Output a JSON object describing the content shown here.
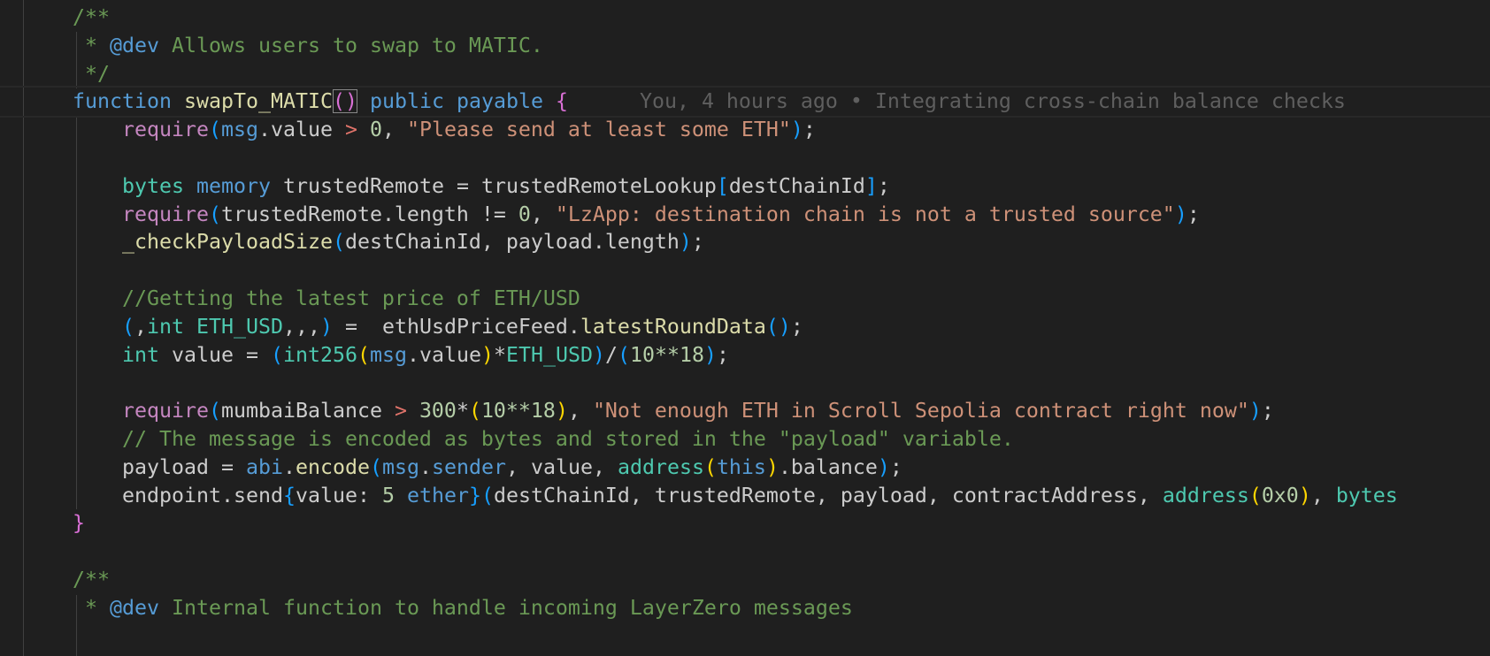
{
  "editor": {
    "language": "solidity",
    "current_line": 4,
    "blame": "You, 4 hours ago • Integrating cross-chain balance checks",
    "colors": {
      "background": "#1f1f1f",
      "keyword": "#569cd6",
      "type": "#4ec9b0",
      "function": "#dcdcaa",
      "control": "#c586c0",
      "string": "#ce9178",
      "number": "#b5cea8",
      "comment": "#6a9955"
    },
    "lines": [
      [
        [
          "    ",
          "d"
        ],
        [
          "/**",
          "c"
        ]
      ],
      [
        [
          "     * ",
          "c"
        ],
        [
          "@dev",
          "k"
        ],
        [
          " Allows users to swap to MATIC.",
          "c"
        ]
      ],
      [
        [
          "     */",
          "c"
        ]
      ],
      [
        [
          "    ",
          "d"
        ],
        [
          "function",
          "k"
        ],
        [
          " ",
          "d"
        ],
        [
          "swapTo_MATIC",
          "f"
        ],
        [
          "()",
          "b2 match"
        ],
        [
          " ",
          "d"
        ],
        [
          "public",
          "k"
        ],
        [
          " ",
          "d"
        ],
        [
          "payable",
          "k"
        ],
        [
          " ",
          "d"
        ],
        [
          "{",
          "b2"
        ]
      ],
      [
        [
          "        ",
          "d"
        ],
        [
          "require",
          "p"
        ],
        [
          "(",
          "b3"
        ],
        [
          "msg",
          "k"
        ],
        [
          ".value ",
          "d"
        ],
        [
          ">",
          "op"
        ],
        [
          " ",
          "d"
        ],
        [
          "0",
          "n"
        ],
        [
          ", ",
          "d"
        ],
        [
          "\"Please send at least some ETH\"",
          "s"
        ],
        [
          ")",
          "b3"
        ],
        [
          ";",
          "d"
        ]
      ],
      [],
      [
        [
          "        ",
          "d"
        ],
        [
          "bytes",
          "t"
        ],
        [
          " ",
          "d"
        ],
        [
          "memory",
          "k"
        ],
        [
          " trustedRemote = trustedRemoteLookup",
          "d"
        ],
        [
          "[",
          "b3"
        ],
        [
          "destChainId",
          "d"
        ],
        [
          "]",
          "b3"
        ],
        [
          ";",
          "d"
        ]
      ],
      [
        [
          "        ",
          "d"
        ],
        [
          "require",
          "p"
        ],
        [
          "(",
          "b3"
        ],
        [
          "trustedRemote.length != ",
          "d"
        ],
        [
          "0",
          "n"
        ],
        [
          ", ",
          "d"
        ],
        [
          "\"LzApp: destination chain is not a trusted source\"",
          "s"
        ],
        [
          ")",
          "b3"
        ],
        [
          ";",
          "d"
        ]
      ],
      [
        [
          "        ",
          "d"
        ],
        [
          "_checkPayloadSize",
          "f"
        ],
        [
          "(",
          "b3"
        ],
        [
          "destChainId, payload.length",
          "d"
        ],
        [
          ")",
          "b3"
        ],
        [
          ";",
          "d"
        ]
      ],
      [],
      [
        [
          "        ",
          "d"
        ],
        [
          "//Getting the latest price of ETH/USD",
          "c"
        ]
      ],
      [
        [
          "        ",
          "d"
        ],
        [
          "(",
          "b3"
        ],
        [
          ",",
          "d"
        ],
        [
          "int",
          "t"
        ],
        [
          " ",
          "d"
        ],
        [
          "ETH_USD",
          "t"
        ],
        [
          ",,,",
          "d"
        ],
        [
          ")",
          "b3"
        ],
        [
          " =  ethUsdPriceFeed.",
          "d"
        ],
        [
          "latestRoundData",
          "f"
        ],
        [
          "()",
          "b3"
        ],
        [
          ";",
          "d"
        ]
      ],
      [
        [
          "        ",
          "d"
        ],
        [
          "int",
          "t"
        ],
        [
          " value = ",
          "d"
        ],
        [
          "(",
          "b3"
        ],
        [
          "int256",
          "t"
        ],
        [
          "(",
          "b1"
        ],
        [
          "msg",
          "k"
        ],
        [
          ".value",
          "d"
        ],
        [
          ")",
          "b1"
        ],
        [
          "*",
          "d"
        ],
        [
          "ETH_USD",
          "t"
        ],
        [
          ")",
          "b3"
        ],
        [
          "/",
          "d"
        ],
        [
          "(",
          "b3"
        ],
        [
          "10**18",
          "n"
        ],
        [
          ")",
          "b3"
        ],
        [
          ";",
          "d"
        ]
      ],
      [],
      [
        [
          "        ",
          "d"
        ],
        [
          "require",
          "p"
        ],
        [
          "(",
          "b3"
        ],
        [
          "mumbaiBalance ",
          "d"
        ],
        [
          ">",
          "op"
        ],
        [
          " ",
          "d"
        ],
        [
          "300",
          "n"
        ],
        [
          "*",
          "d"
        ],
        [
          "(",
          "b1"
        ],
        [
          "10**18",
          "n"
        ],
        [
          ")",
          "b1"
        ],
        [
          ", ",
          "d"
        ],
        [
          "\"Not enough ETH in Scroll Sepolia contract right now\"",
          "s"
        ],
        [
          ")",
          "b3"
        ],
        [
          ";",
          "d"
        ]
      ],
      [
        [
          "        ",
          "d"
        ],
        [
          "// The message is encoded as bytes and stored in the \"payload\" variable.",
          "c"
        ]
      ],
      [
        [
          "        ",
          "d"
        ],
        [
          "payload = ",
          "d"
        ],
        [
          "abi",
          "k"
        ],
        [
          ".",
          "d"
        ],
        [
          "encode",
          "f"
        ],
        [
          "(",
          "b3"
        ],
        [
          "msg",
          "k"
        ],
        [
          ".",
          "d"
        ],
        [
          "sender",
          "k"
        ],
        [
          ", value, ",
          "d"
        ],
        [
          "address",
          "t"
        ],
        [
          "(",
          "b1"
        ],
        [
          "this",
          "k"
        ],
        [
          ")",
          "b1"
        ],
        [
          ".balance",
          "d"
        ],
        [
          ")",
          "b3"
        ],
        [
          ";",
          "d"
        ]
      ],
      [
        [
          "        ",
          "d"
        ],
        [
          "endpoint.send",
          "d"
        ],
        [
          "{",
          "b3"
        ],
        [
          "value: ",
          "d"
        ],
        [
          "5",
          "n"
        ],
        [
          " ",
          "d"
        ],
        [
          "ether",
          "k"
        ],
        [
          "}",
          "b3"
        ],
        [
          "(",
          "b3"
        ],
        [
          "destChainId, trustedRemote, payload, contractAddress, ",
          "d"
        ],
        [
          "address",
          "t"
        ],
        [
          "(",
          "b1"
        ],
        [
          "0x0",
          "n"
        ],
        [
          ")",
          "b1"
        ],
        [
          ", ",
          "d"
        ],
        [
          "bytes",
          "t"
        ]
      ],
      [
        [
          "    ",
          "d"
        ],
        [
          "}",
          "b2"
        ]
      ],
      [],
      [
        [
          "    ",
          "d"
        ],
        [
          "/**",
          "c"
        ]
      ],
      [
        [
          "     * ",
          "c"
        ],
        [
          "@dev",
          "k"
        ],
        [
          " Internal function to handle incoming LayerZero messages",
          "c"
        ]
      ]
    ]
  }
}
